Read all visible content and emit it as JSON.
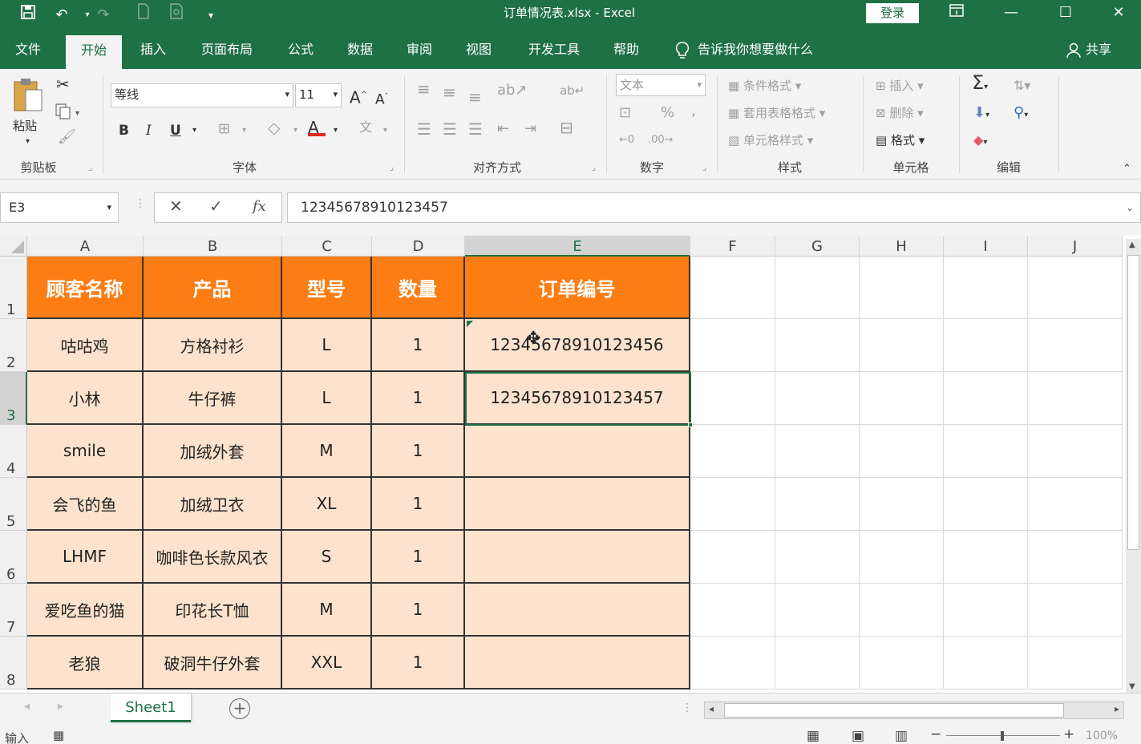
{
  "titlebar": {
    "title": "订单情况表.xlsx  -  Excel",
    "login_label": "登录"
  },
  "menu": {
    "tabs": [
      "文件",
      "开始",
      "插入",
      "页面布局",
      "公式",
      "数据",
      "审阅",
      "视图",
      "开发工具",
      "帮助"
    ],
    "active": "开始",
    "tell_me": "告诉我你想要做什么",
    "share": "共享"
  },
  "ribbon": {
    "clipboard": {
      "label": "剪贴板",
      "paste": "粘贴"
    },
    "font": {
      "label": "字体",
      "font_name": "等线",
      "font_size": "11",
      "bold": "B",
      "italic": "I",
      "underline": "U"
    },
    "alignment": {
      "label": "对齐方式"
    },
    "number": {
      "label": "数字",
      "format": "文本",
      "percent": "%"
    },
    "styles": {
      "label": "样式",
      "conditional": "条件格式",
      "table": "套用表格格式",
      "cell_styles": "单元格样式"
    },
    "cells": {
      "label": "单元格",
      "insert": "插入",
      "delete": "删除",
      "format": "格式"
    },
    "editing": {
      "label": "编辑"
    }
  },
  "formula_bar": {
    "name_box": "E3",
    "formula": "12345678910123457"
  },
  "sheet": {
    "columns": [
      "A",
      "B",
      "C",
      "D",
      "E",
      "F",
      "G",
      "H",
      "I",
      "J"
    ],
    "selected_column": "E",
    "rows": [
      "1",
      "2",
      "3",
      "4",
      "5",
      "6",
      "7",
      "8"
    ],
    "selected_row": "3",
    "headers": [
      "顾客名称",
      "产品",
      "型号",
      "数量",
      "订单编号"
    ],
    "data": [
      [
        "咕咕鸡",
        "方格衬衫",
        "L",
        "1",
        "12345678910123456"
      ],
      [
        "小林",
        "牛仔裤",
        "L",
        "1",
        "12345678910123457"
      ],
      [
        "smile",
        "加绒外套",
        "M",
        "1",
        ""
      ],
      [
        "会飞的鱼",
        "加绒卫衣",
        "XL",
        "1",
        ""
      ],
      [
        "LHMF",
        "咖啡色长款风衣",
        "S",
        "1",
        ""
      ],
      [
        "爱吃鱼的猫",
        "印花长T恤",
        "M",
        "1",
        ""
      ],
      [
        "老狼",
        "破洞牛仔外套",
        "XXL",
        "1",
        ""
      ]
    ]
  },
  "sheet_tabs": {
    "active": "Sheet1"
  },
  "status": {
    "mode": "输入",
    "zoom": "100%"
  },
  "colors": {
    "accent": "#1e7045",
    "header_fill": "#fb7d14",
    "body_fill": "#fde3cd"
  }
}
